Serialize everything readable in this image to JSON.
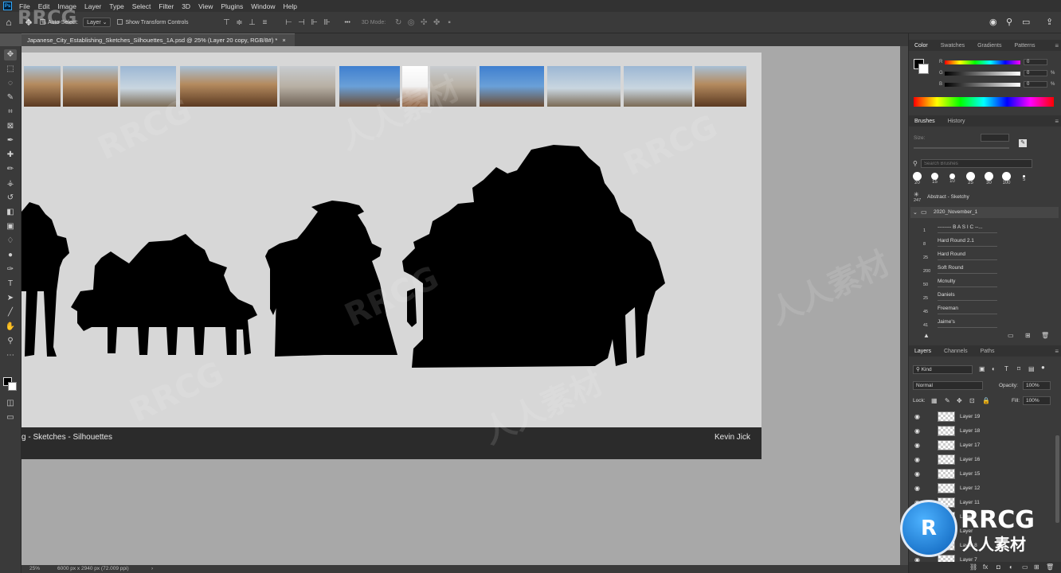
{
  "menubar": {
    "app_badge": "Ps",
    "items": [
      "File",
      "Edit",
      "Image",
      "Layer",
      "Type",
      "Select",
      "Filter",
      "3D",
      "View",
      "Plugins",
      "Window",
      "Help"
    ]
  },
  "options_bar": {
    "auto_select_label": "Auto-Select:",
    "layer_dropdown": "Layer",
    "show_transform_label": "Show Transform Controls",
    "mode_3d_label": "3D Mode:",
    "more_label": "•••"
  },
  "document_tab": {
    "title": "Japanese_City_Establishing_Sketches_Silhouettes_1A.psd @ 25% (Layer 20 copy, RGB/8#) *",
    "close": "×"
  },
  "canvas": {
    "footer_left": "g - Sketches - Silhouettes",
    "footer_right": "Kevin Jick",
    "background_color": "#d7d7d7",
    "silhouette_color": "#000000"
  },
  "status_bar": {
    "zoom": "25%",
    "doc_info": "6000 px x 2940 px (72.009 ppi)",
    "arrow": "›"
  },
  "color_panel": {
    "tabs": [
      "Color",
      "Swatches",
      "Gradients",
      "Patterns"
    ],
    "channels": [
      {
        "label": "R",
        "value": "0",
        "unit": ""
      },
      {
        "label": "G",
        "value": "0",
        "unit": "%"
      },
      {
        "label": "B",
        "value": "0",
        "unit": "%"
      }
    ]
  },
  "brushes_panel": {
    "tabs": [
      "Brushes",
      "History"
    ],
    "size_label": "Size:",
    "search_placeholder": "Search Brushes",
    "tips": [
      "20",
      "15",
      "10",
      "25",
      "30",
      "100",
      "5"
    ],
    "current_brush": {
      "size": "247",
      "name": "Abstract - Sketchy"
    },
    "group": "2020_November_1",
    "brushes": [
      {
        "size": "1",
        "name": "-------- B A S I C --..."
      },
      {
        "size": "8",
        "name": "Hard Round 2.1"
      },
      {
        "size": "25",
        "name": "Hard Round"
      },
      {
        "size": "200",
        "name": "Soft Round"
      },
      {
        "size": "50",
        "name": "Mcnulty"
      },
      {
        "size": "25",
        "name": "Daniels"
      },
      {
        "size": "45",
        "name": "Freeman"
      },
      {
        "size": "41",
        "name": "Jaime's"
      }
    ]
  },
  "layers_panel": {
    "tabs": [
      "Layers",
      "Channels",
      "Paths"
    ],
    "filter_kind": "Kind",
    "blend_mode": "Normal",
    "opacity_label": "Opacity:",
    "opacity_value": "100%",
    "lock_label": "Lock:",
    "fill_label": "Fill:",
    "fill_value": "100%",
    "layers": [
      "Layer 19",
      "Layer 18",
      "Layer 17",
      "Layer 16",
      "Layer 15",
      "Layer 12",
      "Layer 11",
      "Layer",
      "Layer",
      "Layer 8",
      "Layer 7"
    ]
  },
  "watermark": {
    "brand": "RRCG",
    "cn": "人人素材"
  }
}
